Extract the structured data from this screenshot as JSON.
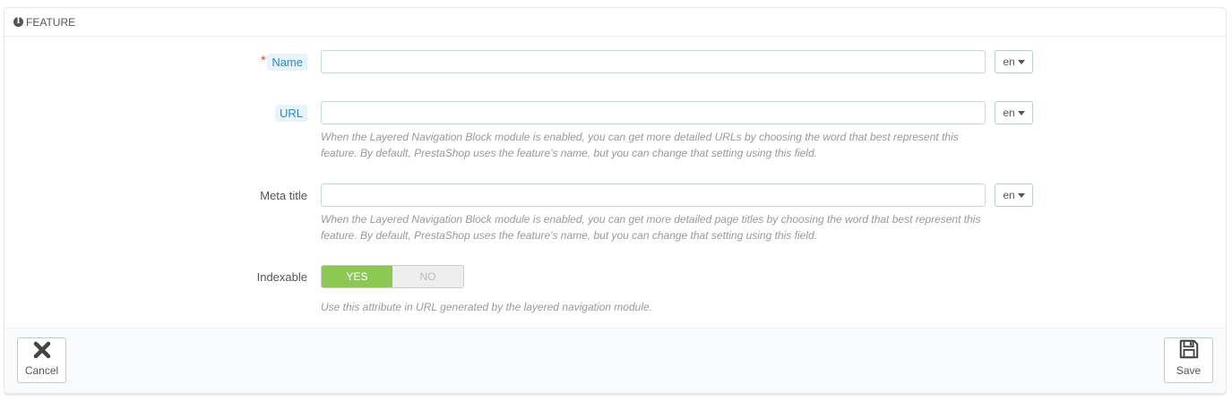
{
  "panel": {
    "heading_icon": "info-circle-icon",
    "heading_title": "FEATURE"
  },
  "fields": {
    "name": {
      "required_mark": "*",
      "label": "Name",
      "value": "",
      "lang": "en"
    },
    "url": {
      "label": "URL",
      "value": "",
      "lang": "en",
      "help": "When the Layered Navigation Block module is enabled, you can get more detailed URLs by choosing the word that best represent this feature. By default, PrestaShop uses the feature's name, but you can change that setting using this field."
    },
    "meta_title": {
      "label": "Meta title",
      "value": "",
      "lang": "en",
      "help": "When the Layered Navigation Block module is enabled, you can get more detailed page titles by choosing the word that best represent this feature. By default, PrestaShop uses the feature's name, but you can change that setting using this field."
    },
    "indexable": {
      "label": "Indexable",
      "yes_label": "YES",
      "no_label": "NO",
      "selected": "YES",
      "help": "Use this attribute in URL generated by the layered navigation module."
    }
  },
  "footer": {
    "cancel_label": "Cancel",
    "cancel_icon": "close-icon",
    "save_label": "Save",
    "save_icon": "save-icon"
  },
  "colors": {
    "switch_on": "#8bc954",
    "label_hint": "#2a8ec4",
    "required": "#e04d3c"
  }
}
